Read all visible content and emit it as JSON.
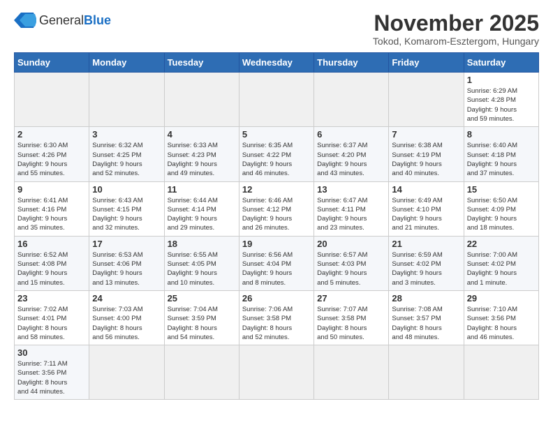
{
  "logo": {
    "general": "General",
    "blue": "Blue"
  },
  "title": "November 2025",
  "location": "Tokod, Komarom-Esztergom, Hungary",
  "weekdays": [
    "Sunday",
    "Monday",
    "Tuesday",
    "Wednesday",
    "Thursday",
    "Friday",
    "Saturday"
  ],
  "weeks": [
    [
      {
        "num": "",
        "info": ""
      },
      {
        "num": "",
        "info": ""
      },
      {
        "num": "",
        "info": ""
      },
      {
        "num": "",
        "info": ""
      },
      {
        "num": "",
        "info": ""
      },
      {
        "num": "",
        "info": ""
      },
      {
        "num": "1",
        "info": "Sunrise: 6:29 AM\nSunset: 4:28 PM\nDaylight: 9 hours\nand 59 minutes."
      }
    ],
    [
      {
        "num": "2",
        "info": "Sunrise: 6:30 AM\nSunset: 4:26 PM\nDaylight: 9 hours\nand 55 minutes."
      },
      {
        "num": "3",
        "info": "Sunrise: 6:32 AM\nSunset: 4:25 PM\nDaylight: 9 hours\nand 52 minutes."
      },
      {
        "num": "4",
        "info": "Sunrise: 6:33 AM\nSunset: 4:23 PM\nDaylight: 9 hours\nand 49 minutes."
      },
      {
        "num": "5",
        "info": "Sunrise: 6:35 AM\nSunset: 4:22 PM\nDaylight: 9 hours\nand 46 minutes."
      },
      {
        "num": "6",
        "info": "Sunrise: 6:37 AM\nSunset: 4:20 PM\nDaylight: 9 hours\nand 43 minutes."
      },
      {
        "num": "7",
        "info": "Sunrise: 6:38 AM\nSunset: 4:19 PM\nDaylight: 9 hours\nand 40 minutes."
      },
      {
        "num": "8",
        "info": "Sunrise: 6:40 AM\nSunset: 4:18 PM\nDaylight: 9 hours\nand 37 minutes."
      }
    ],
    [
      {
        "num": "9",
        "info": "Sunrise: 6:41 AM\nSunset: 4:16 PM\nDaylight: 9 hours\nand 35 minutes."
      },
      {
        "num": "10",
        "info": "Sunrise: 6:43 AM\nSunset: 4:15 PM\nDaylight: 9 hours\nand 32 minutes."
      },
      {
        "num": "11",
        "info": "Sunrise: 6:44 AM\nSunset: 4:14 PM\nDaylight: 9 hours\nand 29 minutes."
      },
      {
        "num": "12",
        "info": "Sunrise: 6:46 AM\nSunset: 4:12 PM\nDaylight: 9 hours\nand 26 minutes."
      },
      {
        "num": "13",
        "info": "Sunrise: 6:47 AM\nSunset: 4:11 PM\nDaylight: 9 hours\nand 23 minutes."
      },
      {
        "num": "14",
        "info": "Sunrise: 6:49 AM\nSunset: 4:10 PM\nDaylight: 9 hours\nand 21 minutes."
      },
      {
        "num": "15",
        "info": "Sunrise: 6:50 AM\nSunset: 4:09 PM\nDaylight: 9 hours\nand 18 minutes."
      }
    ],
    [
      {
        "num": "16",
        "info": "Sunrise: 6:52 AM\nSunset: 4:08 PM\nDaylight: 9 hours\nand 15 minutes."
      },
      {
        "num": "17",
        "info": "Sunrise: 6:53 AM\nSunset: 4:06 PM\nDaylight: 9 hours\nand 13 minutes."
      },
      {
        "num": "18",
        "info": "Sunrise: 6:55 AM\nSunset: 4:05 PM\nDaylight: 9 hours\nand 10 minutes."
      },
      {
        "num": "19",
        "info": "Sunrise: 6:56 AM\nSunset: 4:04 PM\nDaylight: 9 hours\nand 8 minutes."
      },
      {
        "num": "20",
        "info": "Sunrise: 6:57 AM\nSunset: 4:03 PM\nDaylight: 9 hours\nand 5 minutes."
      },
      {
        "num": "21",
        "info": "Sunrise: 6:59 AM\nSunset: 4:02 PM\nDaylight: 9 hours\nand 3 minutes."
      },
      {
        "num": "22",
        "info": "Sunrise: 7:00 AM\nSunset: 4:02 PM\nDaylight: 9 hours\nand 1 minute."
      }
    ],
    [
      {
        "num": "23",
        "info": "Sunrise: 7:02 AM\nSunset: 4:01 PM\nDaylight: 8 hours\nand 58 minutes."
      },
      {
        "num": "24",
        "info": "Sunrise: 7:03 AM\nSunset: 4:00 PM\nDaylight: 8 hours\nand 56 minutes."
      },
      {
        "num": "25",
        "info": "Sunrise: 7:04 AM\nSunset: 3:59 PM\nDaylight: 8 hours\nand 54 minutes."
      },
      {
        "num": "26",
        "info": "Sunrise: 7:06 AM\nSunset: 3:58 PM\nDaylight: 8 hours\nand 52 minutes."
      },
      {
        "num": "27",
        "info": "Sunrise: 7:07 AM\nSunset: 3:58 PM\nDaylight: 8 hours\nand 50 minutes."
      },
      {
        "num": "28",
        "info": "Sunrise: 7:08 AM\nSunset: 3:57 PM\nDaylight: 8 hours\nand 48 minutes."
      },
      {
        "num": "29",
        "info": "Sunrise: 7:10 AM\nSunset: 3:56 PM\nDaylight: 8 hours\nand 46 minutes."
      }
    ],
    [
      {
        "num": "30",
        "info": "Sunrise: 7:11 AM\nSunset: 3:56 PM\nDaylight: 8 hours\nand 44 minutes."
      },
      {
        "num": "",
        "info": ""
      },
      {
        "num": "",
        "info": ""
      },
      {
        "num": "",
        "info": ""
      },
      {
        "num": "",
        "info": ""
      },
      {
        "num": "",
        "info": ""
      },
      {
        "num": "",
        "info": ""
      }
    ]
  ]
}
